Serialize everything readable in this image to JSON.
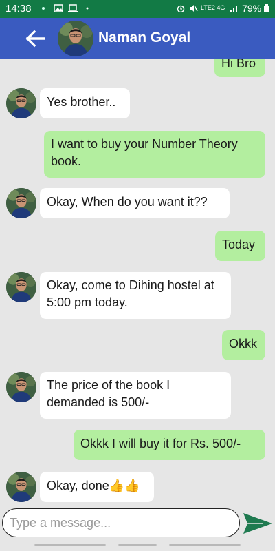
{
  "status_bar": {
    "time": "14:38",
    "network": "LTE2 4G",
    "battery": "79%"
  },
  "header": {
    "contact_name": "Naman Goyal"
  },
  "messages": [
    {
      "side": "outgoing",
      "text": "Hi Bro"
    },
    {
      "side": "incoming",
      "text": "Yes brother.."
    },
    {
      "side": "outgoing",
      "text": "I want to buy your Number Theory book."
    },
    {
      "side": "incoming",
      "text": "Okay,  When do you want it??"
    },
    {
      "side": "outgoing",
      "text": "Today"
    },
    {
      "side": "incoming",
      "text": "Okay,  come to Dihing hostel at 5:00 pm today."
    },
    {
      "side": "outgoing",
      "text": "Okkk"
    },
    {
      "side": "incoming",
      "text": "The price of the book I demanded is 500/-"
    },
    {
      "side": "outgoing",
      "text": "Okkk I will buy it for Rs. 500/-"
    },
    {
      "side": "incoming",
      "text": "Okay,  done👍👍"
    }
  ],
  "composer": {
    "placeholder": "Type a message..."
  },
  "colors": {
    "status_bar": "#127a45",
    "app_bar": "#3a5bc0",
    "incoming_bubble": "#ffffff",
    "outgoing_bubble": "#b3ee9f",
    "send_icon": "#1f7a50"
  }
}
